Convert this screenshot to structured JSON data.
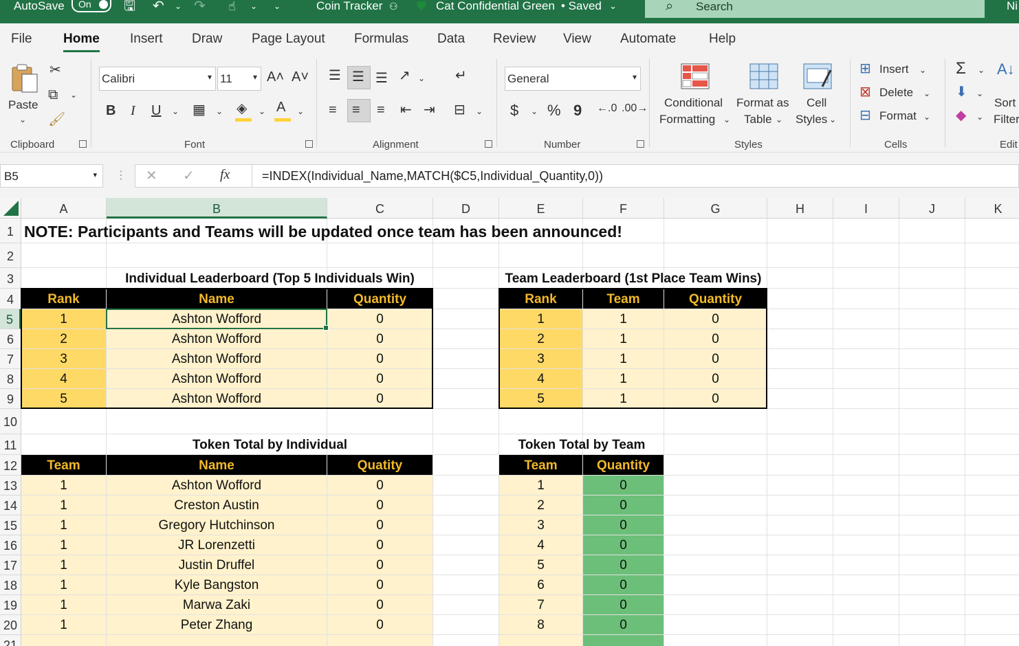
{
  "titlebar": {
    "autosave": "AutoSave",
    "toggle": "On",
    "doc_title": "Coin Tracker",
    "sensitivity": "Cat Confidential Green",
    "status": "• Saved",
    "search_placeholder": "Search",
    "user": "Ni"
  },
  "tabs": [
    "File",
    "Home",
    "Insert",
    "Draw",
    "Page Layout",
    "Formulas",
    "Data",
    "Review",
    "View",
    "Automate",
    "Help"
  ],
  "ribbon": {
    "clipboard": {
      "label": "Clipboard",
      "paste": "Paste"
    },
    "font": {
      "label": "Font",
      "family": "Calibri",
      "size": "11",
      "bold": "B",
      "italic": "I",
      "underline": "U"
    },
    "alignment": {
      "label": "Alignment"
    },
    "number": {
      "label": "Number",
      "format": "General",
      "currency": "$",
      "percent": "%",
      "comma": "9"
    },
    "styles": {
      "label": "Styles",
      "conditional_line1": "Conditional",
      "conditional_line2": "Formatting",
      "table_line1": "Format as",
      "table_line2": "Table",
      "cell_line1": "Cell",
      "cell_line2": "Styles"
    },
    "cells": {
      "label": "Cells",
      "insert": "Insert",
      "delete": "Delete",
      "format": "Format"
    },
    "editing": {
      "label": "Edit",
      "sort_line1": "Sort",
      "sort_line2": "Filter"
    }
  },
  "formula_bar": {
    "name_box": "B5",
    "fx": "fx",
    "formula": "=INDEX(Individual_Name,MATCH($C5,Individual_Quantity,0))"
  },
  "sheet": {
    "columns": [
      "A",
      "B",
      "C",
      "D",
      "E",
      "F",
      "G",
      "H",
      "I",
      "J",
      "K"
    ],
    "rows": [
      "1",
      "2",
      "3",
      "4",
      "5",
      "6",
      "7",
      "8",
      "9",
      "10",
      "11",
      "12",
      "13",
      "14",
      "15",
      "16",
      "17",
      "18",
      "19",
      "20",
      "21"
    ],
    "note": "NOTE: Participants and Teams will be updated once team has been announced!",
    "individual_leaderboard": {
      "title": "Individual Leaderboard (Top 5 Individuals Win)",
      "headers": [
        "Rank",
        "Name",
        "Quantity"
      ],
      "rows": [
        [
          "1",
          "Ashton Wofford",
          "0"
        ],
        [
          "2",
          "Ashton Wofford",
          "0"
        ],
        [
          "3",
          "Ashton Wofford",
          "0"
        ],
        [
          "4",
          "Ashton Wofford",
          "0"
        ],
        [
          "5",
          "Ashton Wofford",
          "0"
        ]
      ]
    },
    "team_leaderboard": {
      "title": "Team Leaderboard (1st Place Team Wins)",
      "headers": [
        "Rank",
        "Team",
        "Quantity"
      ],
      "rows": [
        [
          "1",
          "1",
          "0"
        ],
        [
          "2",
          "1",
          "0"
        ],
        [
          "3",
          "1",
          "0"
        ],
        [
          "4",
          "1",
          "0"
        ],
        [
          "5",
          "1",
          "0"
        ]
      ]
    },
    "token_by_individual": {
      "title": "Token Total by Individual",
      "headers": [
        "Team",
        "Name",
        "Quatity"
      ],
      "rows": [
        [
          "1",
          "Ashton Wofford",
          "0"
        ],
        [
          "1",
          "Creston Austin",
          "0"
        ],
        [
          "1",
          "Gregory Hutchinson",
          "0"
        ],
        [
          "1",
          "JR Lorenzetti",
          "0"
        ],
        [
          "1",
          "Justin Druffel",
          "0"
        ],
        [
          "1",
          "Kyle Bangston",
          "0"
        ],
        [
          "1",
          "Marwa Zaki",
          "0"
        ],
        [
          "1",
          "Peter Zhang",
          "0"
        ]
      ]
    },
    "token_by_team": {
      "title": "Token Total by Team",
      "headers": [
        "Team",
        "Quantity"
      ],
      "rows": [
        [
          "1",
          "0"
        ],
        [
          "2",
          "0"
        ],
        [
          "3",
          "0"
        ],
        [
          "4",
          "0"
        ],
        [
          "5",
          "0"
        ],
        [
          "6",
          "0"
        ],
        [
          "7",
          "0"
        ],
        [
          "8",
          "0"
        ]
      ]
    },
    "colors": {
      "header_bg": "#000000",
      "header_text": "#f2b92b",
      "rank_fill": "#fed966",
      "body_fill": "#fff2cc",
      "team_qty_fill": "#6cbf78",
      "accent": "#217346"
    }
  }
}
